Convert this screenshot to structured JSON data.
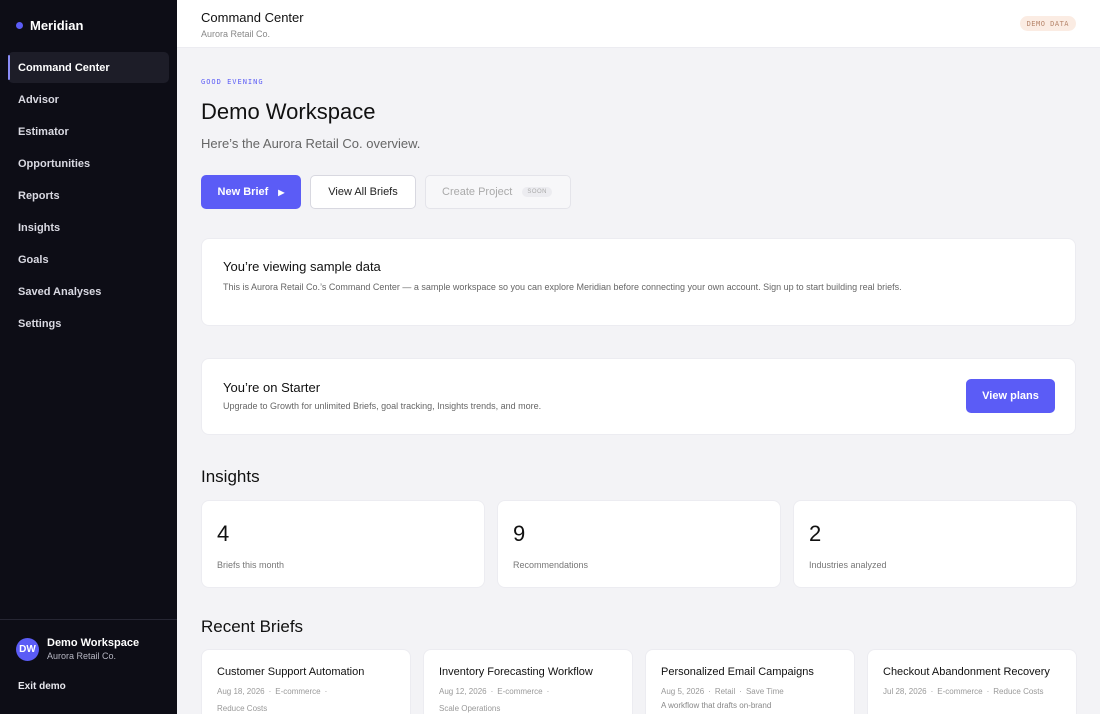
{
  "sidebar": {
    "brand": "Meridian",
    "items": [
      {
        "label": "Command Center"
      },
      {
        "label": "Advisor"
      },
      {
        "label": "Estimator"
      },
      {
        "label": "Opportunities"
      },
      {
        "label": "Reports"
      },
      {
        "label": "Insights"
      },
      {
        "label": "Goals"
      },
      {
        "label": "Saved Analyses"
      },
      {
        "label": "Settings"
      }
    ],
    "user": {
      "initials": "DW",
      "name": "Demo Workspace",
      "org": "Aurora Retail Co."
    },
    "exit_label": "Exit demo"
  },
  "header": {
    "title": "Command Center",
    "subtitle": "Aurora Retail Co.",
    "badge": "DEMO DATA"
  },
  "main": {
    "greeting": "GOOD EVENING",
    "title": "Demo Workspace",
    "subtitle": "Here’s the Aurora Retail Co. overview.",
    "actions": {
      "new_brief": "New Brief",
      "view_all": "View All Briefs",
      "create_project": "Create Project",
      "soon": "SOON"
    },
    "sample_card": {
      "title": "You’re viewing sample data",
      "text": "This is Aurora Retail Co.’s Command Center — a sample workspace so you can explore Meridian before connecting your own account. Sign up to start building real briefs."
    },
    "starter_card": {
      "title": "You’re on Starter",
      "text": "Upgrade to Growth for unlimited Briefs, goal tracking, Insights trends, and more.",
      "button": "View plans"
    },
    "insights": {
      "title": "Insights",
      "stats": [
        {
          "value": "4",
          "label": "Briefs this month"
        },
        {
          "value": "9",
          "label": "Recommendations"
        },
        {
          "value": "2",
          "label": "Industries analyzed"
        }
      ]
    },
    "recent_briefs": {
      "title": "Recent Briefs",
      "items": [
        {
          "title": "Customer Support Automation",
          "date": "Aug 18, 2026",
          "industry": "E-commerce",
          "goal": "Reduce Costs"
        },
        {
          "title": "Inventory Forecasting Workflow",
          "date": "Aug 12, 2026",
          "industry": "E-commerce",
          "goal": "Scale Operations"
        },
        {
          "title": "Personalized Email Campaigns",
          "date": "Aug 5, 2026",
          "industry": "Retail",
          "goal": "Save Time",
          "desc": "A workflow that drafts on-brand"
        },
        {
          "title": "Checkout Abandonment Recovery",
          "date": "Jul 28, 2026",
          "industry": "E-commerce",
          "goal": "Reduce Costs"
        }
      ]
    }
  },
  "colors": {
    "accent": "#5b5cf6",
    "sidebar_bg": "#0d0d16",
    "page_bg": "#f3f3f6"
  }
}
